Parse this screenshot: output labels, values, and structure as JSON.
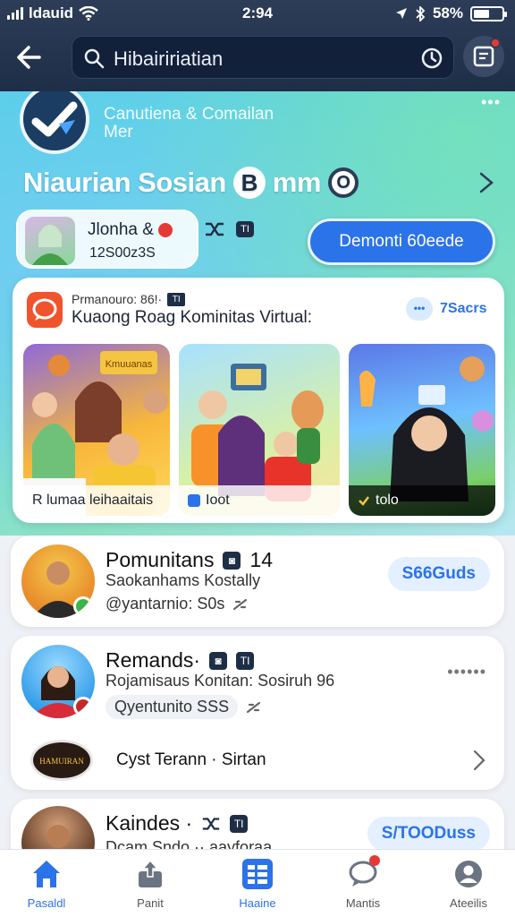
{
  "status_bar": {
    "carrier": "ldauid",
    "time": "2:94",
    "battery": "58%"
  },
  "search": {
    "query": "Hibaiririatian"
  },
  "hero": {
    "more": "•••",
    "tagline_line1": "Canutiena & Comailan",
    "tagline_line2": "Mer",
    "title": "Niaurian Sosian",
    "title_badge_b": "B",
    "title_suffix": "mm",
    "title_badge_o": "O",
    "profile_name": "Jlonha &",
    "profile_count": "12S00z3S",
    "icon_tag": "TI",
    "cta_label": "Demonti 60eede"
  },
  "featured": {
    "meta": "Prmanouro: 86!·",
    "meta_tag": "TI",
    "title": "Kuaong Roag Kominitas Virtual:",
    "count": "7Sacrs",
    "thumbs": [
      {
        "caption": "R lumaa leihaaitais",
        "banner": "Kmuuanas"
      },
      {
        "caption": "Ioot"
      },
      {
        "caption": "tolo"
      }
    ]
  },
  "cards": [
    {
      "name": "Pomunitans",
      "count": "14",
      "subtitle": "Saokanhams Kostally",
      "handle": "@yantarnio: S0s",
      "pill": "S66Guds"
    },
    {
      "name": "Remands·",
      "subtitle": "Rojamisaus Konitan: Sosiruh 96",
      "handle": "Qyentunito SSS",
      "more": "••••••",
      "subrow_text": "Cyst Terann · Sirtan",
      "subrow_logo_text": "HAMUIRAN"
    },
    {
      "name": "Kaindes ·",
      "subtitle": "Dcam Sndo ·· aayforaa",
      "pill": "S/TOODuss"
    }
  ],
  "bottom_nav": [
    {
      "label": "Pasaldl",
      "icon": "home-icon"
    },
    {
      "label": "Panit",
      "icon": "upload-icon"
    },
    {
      "label": "Haaine",
      "icon": "grid-icon"
    },
    {
      "label": "Mantis",
      "icon": "chat-icon"
    },
    {
      "label": "Ateeilis",
      "icon": "profile-icon"
    }
  ],
  "colors": {
    "header_bg": "#2d3d58",
    "accent": "#2b73e8",
    "notification": "#e53935",
    "hero_gradient_start": "#58cfe8",
    "hero_gradient_end": "#8ee3c7"
  }
}
